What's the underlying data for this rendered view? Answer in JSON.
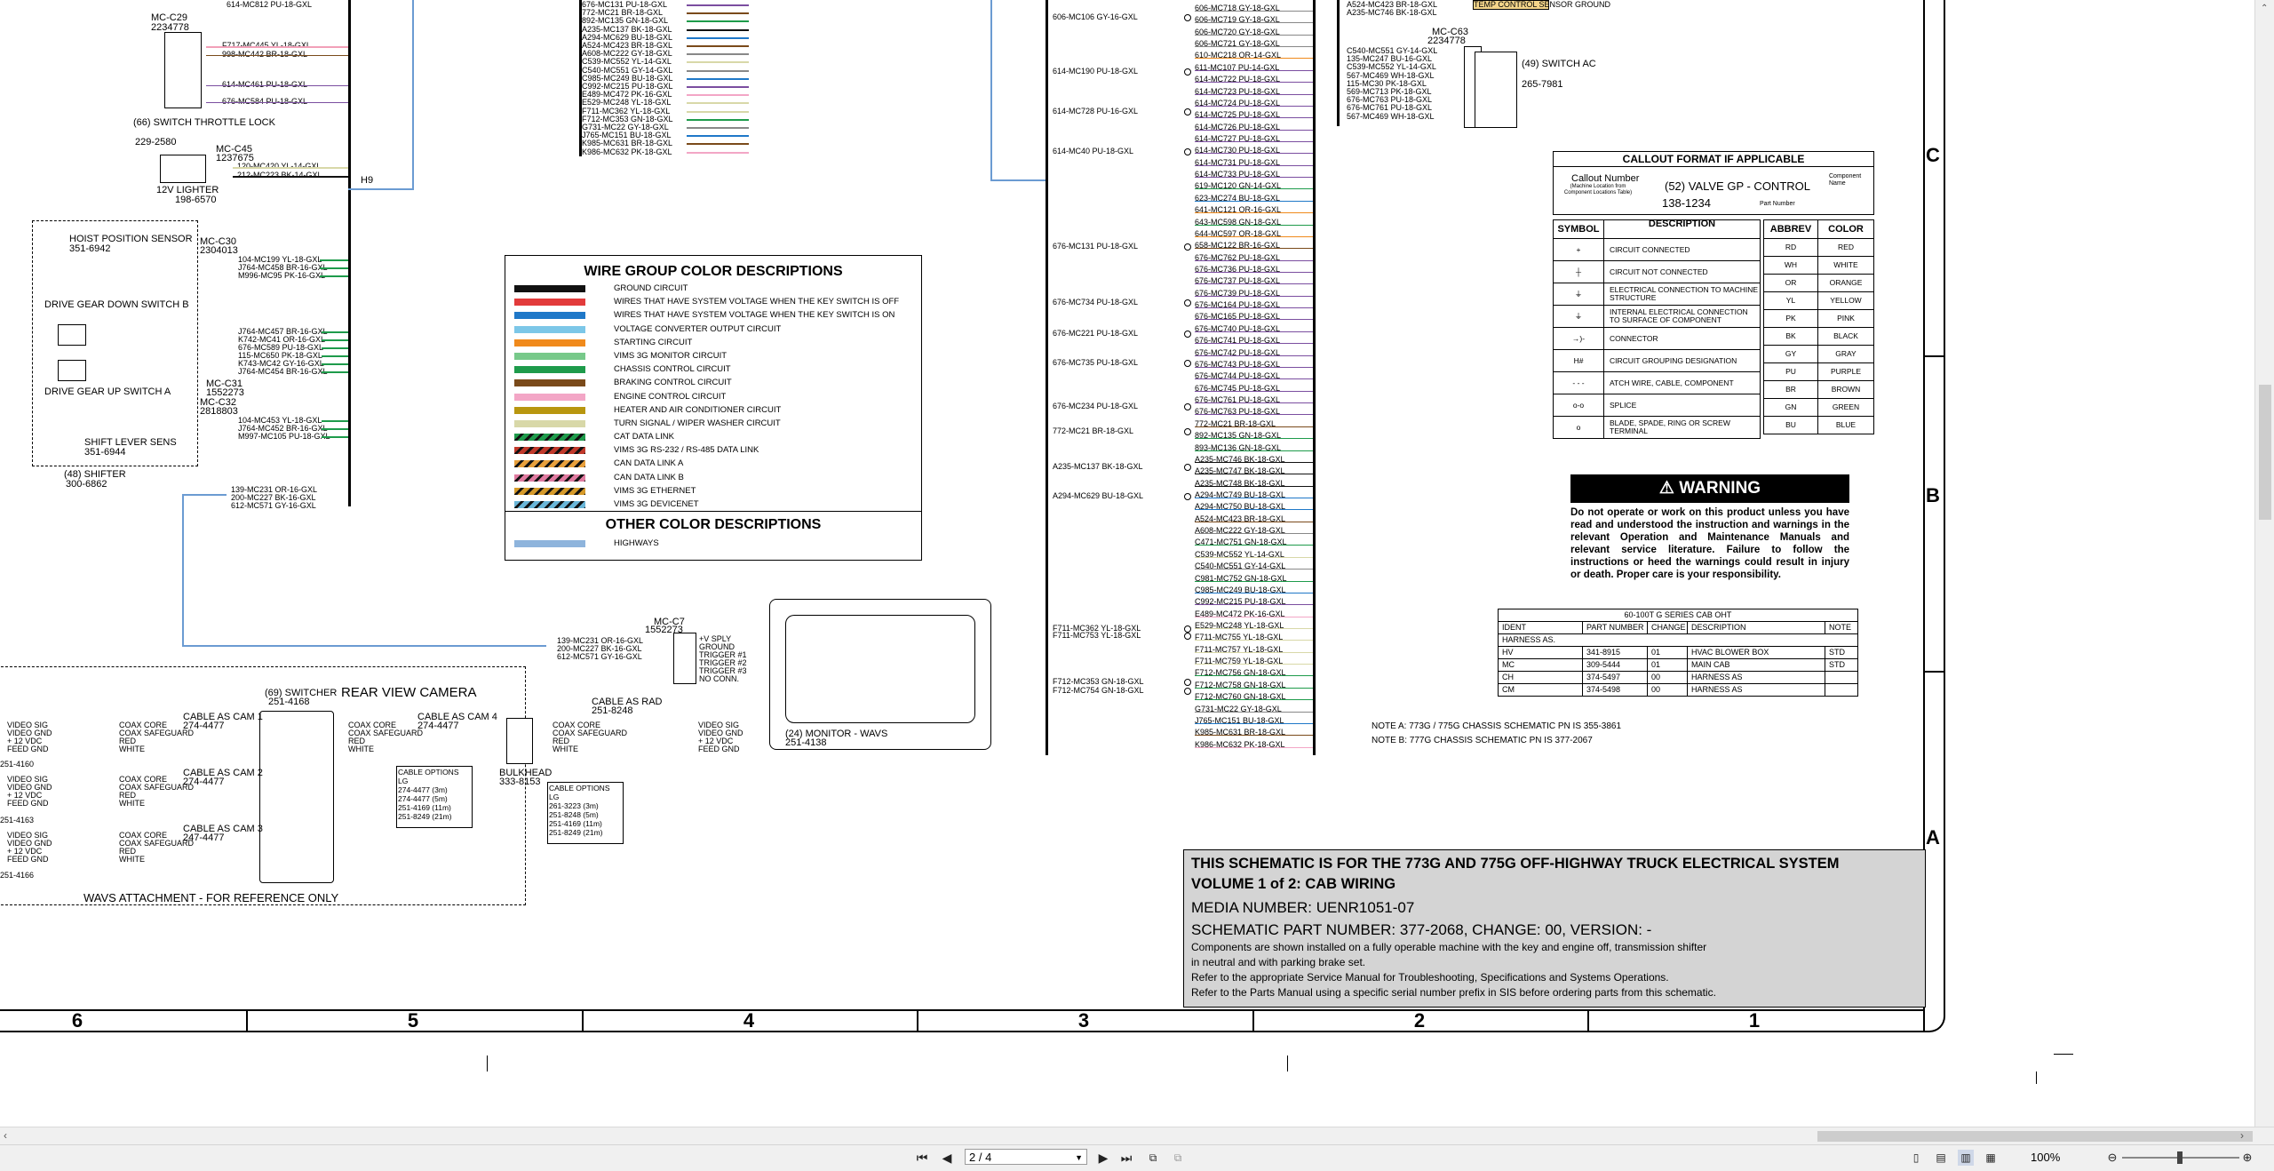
{
  "legend": {
    "title": "WIRE GROUP COLOR DESCRIPTIONS",
    "rows": [
      {
        "color": "#111111",
        "pattern": "solid",
        "label": "GROUND CIRCUIT"
      },
      {
        "color": "#e23b3b",
        "pattern": "solid",
        "label": "WIRES THAT HAVE SYSTEM VOLTAGE WHEN THE KEY SWITCH IS OFF"
      },
      {
        "color": "#1f78c8",
        "pattern": "solid",
        "label": "WIRES THAT HAVE SYSTEM VOLTAGE WHEN THE KEY SWITCH IS ON"
      },
      {
        "color": "#7cc7e8",
        "pattern": "solid",
        "label": "VOLTAGE CONVERTER OUTPUT CIRCUIT"
      },
      {
        "color": "#f08a1c",
        "pattern": "solid",
        "label": "STARTING CIRCUIT"
      },
      {
        "color": "#77c98a",
        "pattern": "solid",
        "label": "VIMS 3G MONITOR CIRCUIT"
      },
      {
        "color": "#1e9b4b",
        "pattern": "solid",
        "label": "CHASSIS CONTROL CIRCUIT"
      },
      {
        "color": "#7a4a1a",
        "pattern": "solid",
        "label": "BRAKING CONTROL CIRCUIT"
      },
      {
        "color": "#f3a6c6",
        "pattern": "solid",
        "label": "ENGINE CONTROL CIRCUIT"
      },
      {
        "color": "#b8960f",
        "pattern": "solid",
        "label": "HEATER AND AIR CONDITIONER CIRCUIT"
      },
      {
        "color": "#d8d8a8",
        "pattern": "solid",
        "label": "TURN SIGNAL / WIPER WASHER CIRCUIT"
      },
      {
        "color": "#1e9b4b",
        "pattern": "striped",
        "label": "CAT DATA LINK"
      },
      {
        "color": "#c0392b",
        "pattern": "striped",
        "label": "VIMS 3G RS-232 / RS-485 DATA LINK"
      },
      {
        "color": "#e8a03c",
        "pattern": "striped",
        "label": "CAN DATA LINK A"
      },
      {
        "color": "#e07aa0",
        "pattern": "striped",
        "label": "CAN DATA LINK B"
      },
      {
        "color": "#d69a2a",
        "pattern": "striped",
        "label": "VIMS 3G ETHERNET"
      },
      {
        "color": "#6ab6d8",
        "pattern": "striped",
        "label": "VIMS 3G DEVICENET"
      }
    ],
    "other_title": "OTHER COLOR DESCRIPTIONS",
    "other_rows": [
      {
        "color": "#8eb4dc",
        "pattern": "solid",
        "label": "HIGHWAYS"
      }
    ]
  },
  "callout": {
    "title": "CALLOUT FORMAT IF APPLICABLE",
    "number_label": "Callout Number",
    "number_note": "(Machine Location from Component Locations Table)",
    "component": "(52) VALVE GP - CONTROL",
    "component_name": "Component Name",
    "part": "138-1234",
    "part_label": "Part Number"
  },
  "symbols": {
    "h1": "SYMBOL",
    "h2": "DESCRIPTION",
    "rows": [
      {
        "sym": "+",
        "desc": "CIRCUIT CONNECTED"
      },
      {
        "sym": "┼",
        "desc": "CIRCUIT NOT CONNECTED"
      },
      {
        "sym": "⏚",
        "desc": "ELECTRICAL CONNECTION TO MACHINE STRUCTURE"
      },
      {
        "sym": "⏚",
        "desc": "INTERNAL ELECTRICAL CONNECTION TO SURFACE OF COMPONENT"
      },
      {
        "sym": "→)-",
        "desc": "CONNECTOR"
      },
      {
        "sym": "H#",
        "desc": "CIRCUIT GROUPING DESIGNATION"
      },
      {
        "sym": "- - -",
        "desc": "ATCH WIRE, CABLE, COMPONENT"
      },
      {
        "sym": "o-o",
        "desc": "SPLICE"
      },
      {
        "sym": "o",
        "desc": "BLADE, SPADE, RING OR SCREW TERMINAL"
      }
    ]
  },
  "colors": {
    "h1": "ABBREV",
    "h2": "COLOR",
    "rows": [
      {
        "a": "RD",
        "c": "RED"
      },
      {
        "a": "WH",
        "c": "WHITE"
      },
      {
        "a": "OR",
        "c": "ORANGE"
      },
      {
        "a": "YL",
        "c": "YELLOW"
      },
      {
        "a": "PK",
        "c": "PINK"
      },
      {
        "a": "BK",
        "c": "BLACK"
      },
      {
        "a": "GY",
        "c": "GRAY"
      },
      {
        "a": "PU",
        "c": "PURPLE"
      },
      {
        "a": "BR",
        "c": "BROWN"
      },
      {
        "a": "GN",
        "c": "GREEN"
      },
      {
        "a": "BU",
        "c": "BLUE"
      }
    ]
  },
  "warning": {
    "title": "WARNING",
    "text": "Do not operate or work on this product unless you have read and understood the instruction and warnings in the relevant Operation and Maintenance Manuals and relevant service literature. Failure to follow the instructions or heed the warnings could result in injury or death. Proper care is your responsibility."
  },
  "parts": {
    "title": "60-100T G SERIES CAB OHT",
    "headers": [
      "IDENT",
      "PART NUMBER",
      "CHANGE",
      "DESCRIPTION",
      "NOTE"
    ],
    "sub": "HARNESS AS.",
    "rows": [
      [
        "HV",
        "341-8915",
        "01",
        "HVAC BLOWER BOX",
        "STD"
      ],
      [
        "MC",
        "309-5444",
        "01",
        "MAIN CAB",
        "STD"
      ],
      [
        "CH",
        "374-5497",
        "00",
        "HARNESS AS",
        ""
      ],
      [
        "CM",
        "374-5498",
        "00",
        "HARNESS AS",
        ""
      ]
    ]
  },
  "notes": {
    "a": "NOTE A: 773G / 775G CHASSIS SCHEMATIC PN IS 355-3861",
    "b": "NOTE B: 777G CHASSIS SCHEMATIC PN IS 377-2067"
  },
  "titleblock": {
    "line1": "THIS SCHEMATIC IS FOR THE 773G AND 775G OFF-HIGHWAY TRUCK ELECTRICAL SYSTEM",
    "line2": "VOLUME 1 of 2: CAB WIRING",
    "line3": "MEDIA NUMBER: UENR1051-07",
    "line4": "SCHEMATIC PART NUMBER: 377-2068, CHANGE: 00, VERSION: -",
    "note1": "Components are shown installed on a fully operable machine with the key and engine off, transmission shifter",
    "note2": "in neutral and with parking brake set.",
    "note3": "Refer to the appropriate Service Manual for Troubleshooting, Specifications and Systems Operations.",
    "note4": "Refer to the Parts Manual using a specific serial number prefix in SIS before ordering parts from this schematic."
  },
  "zones": {
    "rows": [
      "C",
      "B",
      "A"
    ],
    "cols": [
      "6",
      "5",
      "4",
      "3",
      "2",
      "1"
    ]
  },
  "left_components": {
    "switch_throttle": "(66) SWITCH THROTTLE LOCK",
    "switch_throttle_pn": "229-2580",
    "mc_c29": "MC-C29",
    "mc_c29_pn": "2234778",
    "lighter": "12V LIGHTER",
    "lighter_pn": "198-6570",
    "mc_c45": "MC-C45",
    "mc_c45_pn": "1237675",
    "hoist": "HOIST POSITION SENSOR",
    "hoist_pn": "351-6942",
    "mc_c30": "MC-C30",
    "mc_c30_pn": "2304013",
    "gear_down": "DRIVE GEAR DOWN SWITCH B",
    "gear_up": "DRIVE GEAR UP SWITCH A",
    "mc_c31": "MC-C31",
    "mc_c31_pn": "1552273",
    "mc_c32": "MC-C32",
    "mc_c32_pn": "2818803",
    "shift_sens": "SHIFT LEVER SENS",
    "shift_sens_pn": "351-6944",
    "shifter": "(48) SHIFTER",
    "shifter_pn": "300-6862",
    "h9": "H9"
  },
  "camera": {
    "title": "REAR VIEW CAMERA",
    "switcher": "(69) SWITCHER",
    "switcher_pn": "251-4168",
    "cable_cam1": "CABLE AS CAM 1",
    "cable_cam1_pn": "274-4477",
    "cable_cam2": "CABLE AS CAM 2",
    "cable_cam2_pn": "274-4477",
    "cable_cam3": "CABLE AS CAM 3",
    "cable_cam3_pn": "247-4477",
    "cable_cam4": "CABLE AS CAM 4",
    "cable_cam4_pn": "274-4477",
    "cable_rad": "CABLE AS RAD",
    "cable_rad_pn": "251-8248",
    "bulkhead": "BULKHEAD",
    "bulkhead_pn": "333-8153",
    "monitor": "(24) MONITOR - WAVS",
    "monitor_pn": "251-4138",
    "mc_c7": "MC-C7",
    "mc_c7_pn": "1552273",
    "footer": "WAVS ATTACHMENT - FOR REFERENCE ONLY",
    "cam_pns": [
      "251-4160",
      "251-4163",
      "251-4166"
    ],
    "pins": [
      "VIDEO SIG",
      "VIDEO GND",
      "+ 12 VDC",
      "FEED GND"
    ],
    "cable_pins": [
      "COAX CORE",
      "COAX SAFEGUARD",
      "RED",
      "WHITE"
    ],
    "cable_options_title": "CABLE OPTIONS",
    "cable_options_lg": "LG",
    "cable_options_1": [
      [
        "274-4477",
        "(3m)"
      ],
      [
        "274-4477",
        "(5m)"
      ],
      [
        "251-4169",
        "(11m)"
      ],
      [
        "251-8249",
        "(21m)"
      ]
    ],
    "cable_options_2": [
      [
        "261-3223",
        "(3m)"
      ],
      [
        "251-8248",
        "(5m)"
      ],
      [
        "251-4169",
        "(11m)"
      ],
      [
        "251-8249",
        "(21m)"
      ]
    ]
  },
  "right_components": {
    "mc_c63": "MC-C63",
    "mc_c63_pn": "2234778",
    "switch_ac": "(49) SWITCH AC",
    "switch_ac_pn": "265-7981",
    "temp_box": "TEMP CONTROL SENSOR GROUND"
  },
  "center_wires": {
    "top_left_labels": [
      "676-MC131 PU-18-GXL",
      "772-MC21 BR-18-GXL",
      "892-MC135 GN-18-GXL",
      "A235-MC137 BK-18-GXL",
      "A294-MC629 BU-18-GXL",
      "A524-MC423 BR-18-GXL",
      "A608-MC222 GY-18-GXL",
      "C539-MC552 YL-14-GXL",
      "C540-MC551 GY-14-GXL",
      "C985-MC249 BU-18-GXL",
      "C992-MC215 PU-18-GXL",
      "E489-MC472 PK-16-GXL",
      "E529-MC248 YL-18-GXL",
      "F711-MC362 YL-18-GXL",
      "F712-MC353 GN-18-GXL",
      "G731-MC22 GY-18-GXL",
      "J765-MC151 BU-18-GXL",
      "K985-MC631 BR-18-GXL",
      "K986-MC632 PK-18-GXL"
    ],
    "right_bus_labels": [
      "606-MC718 GY-18-GXL",
      "606-MC719 GY-18-GXL",
      "606-MC720 GY-18-GXL",
      "606-MC721 GY-18-GXL",
      "610-MC218 OR-14-GXL",
      "611-MC107 PU-14-GXL",
      "614-MC722 PU-18-GXL",
      "614-MC723 PU-18-GXL",
      "614-MC724 PU-18-GXL",
      "614-MC725 PU-18-GXL",
      "614-MC726 PU-18-GXL",
      "614-MC727 PU-18-GXL",
      "614-MC730 PU-18-GXL",
      "614-MC731 PU-18-GXL",
      "614-MC733 PU-18-GXL",
      "619-MC120 GN-14-GXL",
      "623-MC274 BU-18-GXL",
      "641-MC121 OR-16-GXL",
      "643-MC598 GN-18-GXL",
      "644-MC597 OR-18-GXL",
      "658-MC122 BR-16-GXL",
      "676-MC762 PU-18-GXL",
      "676-MC736 PU-18-GXL",
      "676-MC737 PU-18-GXL",
      "676-MC739 PU-18-GXL",
      "676-MC164 PU-18-GXL",
      "676-MC165 PU-18-GXL",
      "676-MC740 PU-18-GXL",
      "676-MC741 PU-18-GXL",
      "676-MC742 PU-18-GXL",
      "676-MC743 PU-18-GXL",
      "676-MC744 PU-18-GXL",
      "676-MC745 PU-18-GXL",
      "676-MC761 PU-18-GXL",
      "676-MC763 PU-18-GXL",
      "772-MC21 BR-18-GXL",
      "892-MC135 GN-18-GXL",
      "893-MC136 GN-18-GXL",
      "A235-MC746 BK-18-GXL",
      "A235-MC747 BK-18-GXL",
      "A235-MC748 BK-18-GXL",
      "A294-MC749 BU-18-GXL",
      "A294-MC750 BU-18-GXL",
      "A524-MC423 BR-18-GXL",
      "A608-MC222 GY-18-GXL",
      "C471-MC751 GN-18-GXL",
      "C539-MC552 YL-14-GXL",
      "C540-MC551 GY-14-GXL",
      "C981-MC752 GN-18-GXL",
      "C985-MC249 BU-18-GXL",
      "C992-MC215 PU-18-GXL",
      "E489-MC472 PK-16-GXL",
      "E529-MC248 YL-18-GXL",
      "F711-MC755 YL-18-GXL",
      "F711-MC757 YL-18-GXL",
      "F711-MC759 YL-18-GXL",
      "F712-MC756 GN-18-GXL",
      "F712-MC758 GN-18-GXL",
      "F712-MC760 GN-18-GXL",
      "G731-MC22 GY-18-GXL",
      "J765-MC151 BU-18-GXL",
      "K985-MC631 BR-18-GXL",
      "K986-MC632 PK-18-GXL"
    ],
    "left_splice_labels": [
      "606-MC106 GY-16-GXL",
      "614-MC190 PU-18-GXL",
      "614-MC728 PU-16-GXL",
      "614-MC40 PU-18-GXL",
      "676-MC131 PU-18-GXL",
      "676-MC734 PU-18-GXL",
      "676-MC221 PU-18-GXL",
      "676-MC735 PU-18-GXL",
      "676-MC234 PU-18-GXL",
      "772-MC21 BR-18-GXL",
      "A235-MC137 BK-18-GXL",
      "A294-MC629 BU-18-GXL",
      "F711-MC362 YL-18-GXL",
      "F711-MC753 YL-18-GXL",
      "F712-MC353 GN-18-GXL",
      "F712-MC754 GN-18-GXL"
    ]
  },
  "viewer": {
    "page_value": "2 / 4",
    "zoom": "100%",
    "first": "⏮",
    "prev": "◀",
    "next": "▶",
    "last": "⏭"
  }
}
